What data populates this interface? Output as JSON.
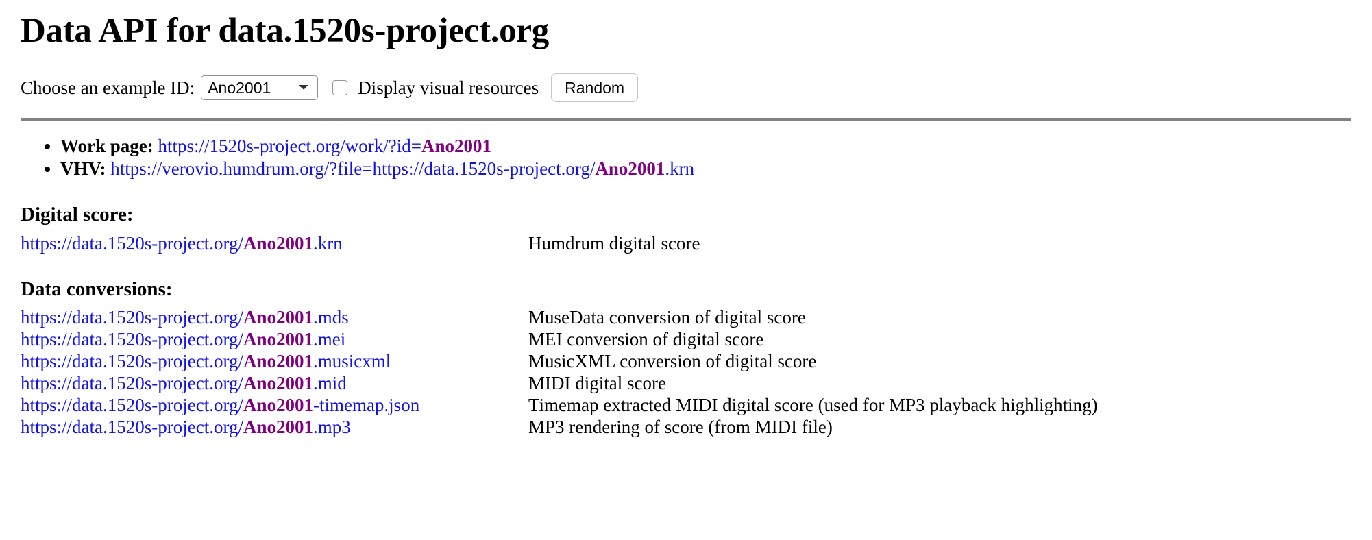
{
  "page": {
    "title": "Data API for data.1520s-project.org",
    "example_id": "Ano2001"
  },
  "colors": {
    "link": "#1414e0",
    "id_highlight": "#800080",
    "divider": "#828282"
  },
  "controls": {
    "choose_label": "Choose an example ID:",
    "select": {
      "value": "Ano2001",
      "options": [
        "Ano2001"
      ],
      "icon": "chevron-down-icon"
    },
    "checkbox": {
      "label": "Display visual resources",
      "checked": false
    },
    "random_button": "Random"
  },
  "quick_links": [
    {
      "label": "Work page:",
      "label_bold": true,
      "url_prefix": "https://1520s-project.org/work/?id=",
      "url_id": "Ano2001",
      "url_suffix": ""
    },
    {
      "label": "VHV:",
      "label_bold": true,
      "url_prefix": "https://verovio.humdrum.org/?file=https://data.1520s-project.org/",
      "url_id": "Ano2001",
      "url_suffix": ".krn"
    }
  ],
  "sections": [
    {
      "heading": "Digital score:",
      "rows": [
        {
          "url_prefix": "https://data.1520s-project.org/",
          "url_id": "Ano2001",
          "url_suffix": ".krn",
          "description": "Humdrum digital score"
        }
      ]
    },
    {
      "heading": "Data conversions:",
      "rows": [
        {
          "url_prefix": "https://data.1520s-project.org/",
          "url_id": "Ano2001",
          "url_suffix": ".mds",
          "description": "MuseData conversion of digital score"
        },
        {
          "url_prefix": "https://data.1520s-project.org/",
          "url_id": "Ano2001",
          "url_suffix": ".mei",
          "description": "MEI conversion of digital score"
        },
        {
          "url_prefix": "https://data.1520s-project.org/",
          "url_id": "Ano2001",
          "url_suffix": ".musicxml",
          "description": "MusicXML conversion of digital score"
        },
        {
          "url_prefix": "https://data.1520s-project.org/",
          "url_id": "Ano2001",
          "url_suffix": ".mid",
          "description": "MIDI digital score"
        },
        {
          "url_prefix": "https://data.1520s-project.org/",
          "url_id": "Ano2001",
          "url_suffix": "-timemap.json",
          "description": "Timemap extracted MIDI digital score (used for MP3 playback highlighting)"
        },
        {
          "url_prefix": "https://data.1520s-project.org/",
          "url_id": "Ano2001",
          "url_suffix": ".mp3",
          "description": "MP3 rendering of score (from MIDI file)"
        }
      ]
    }
  ]
}
